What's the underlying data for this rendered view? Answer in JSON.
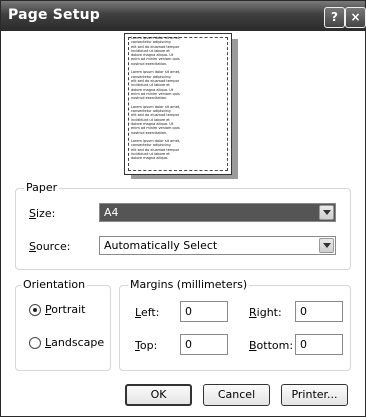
{
  "window": {
    "title": "Page Setup",
    "help_label": "?",
    "close_label": "×"
  },
  "preview": {
    "sample_text": "Lorem ipsum dolor sit amet,\nconsectetur adipiscing\nelit sed do eiusmod tempor\nincididunt ut labore et\ndolore magna aliqua. Ut\nenim ad minim veniam quis\nnostrud exercitation.\n\nLorem ipsum dolor sit amet,\nconsectetur adipiscing\nelit sed do eiusmod tempor\nincididunt ut labore et\ndolore magna aliqua. Ut\nenim ad minim veniam quis\nnostrud exercitation.\n\nLorem ipsum dolor sit amet,\nconsectetur adipiscing\nelit sed do eiusmod tempor\nincididunt ut labore et\ndolore magna aliqua. Ut\nenim ad minim veniam quis\nnostrud exercitation.\n\nLorem ipsum dolor sit amet,\nconsectetur adipiscing\nelit sed do eiusmod tempor\nincididunt ut labore et\ndolore magna aliqua."
  },
  "paper": {
    "group_label": "Paper",
    "size_label_key": "S",
    "size_label_rest": "ize:",
    "size_value": "A4",
    "source_label_key": "S",
    "source_label_rest": "ource:",
    "source_value": "Automatically Select"
  },
  "orientation": {
    "group_label": "Orientation",
    "portrait_key": "P",
    "portrait_rest": "ortrait",
    "landscape_key": "L",
    "landscape_rest": "andscape",
    "selected": "Portrait"
  },
  "margins": {
    "group_label": "Margins (millimeters)",
    "left_key": "L",
    "left_rest": "eft:",
    "left_value": "0",
    "right_key": "R",
    "right_rest": "ight:",
    "right_value": "0",
    "top_key": "T",
    "top_rest": "op:",
    "top_value": "0",
    "bottom_key": "B",
    "bottom_rest": "ottom:",
    "bottom_value": "0"
  },
  "buttons": {
    "ok": "OK",
    "cancel": "Cancel",
    "printer": "Printer..."
  }
}
